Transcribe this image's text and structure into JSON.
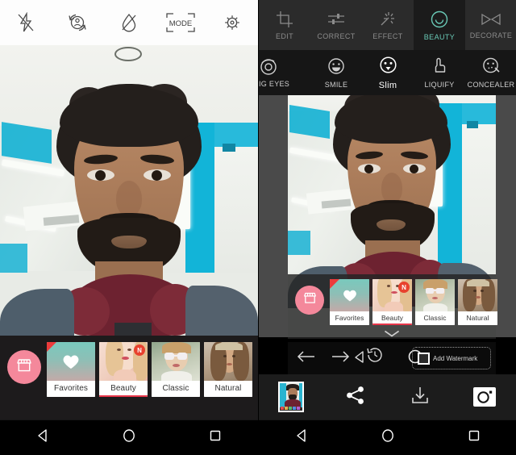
{
  "left_panel": {
    "name": "camera-screen",
    "toolbar": {
      "items": [
        {
          "icon": "flash-off-icon",
          "label": ""
        },
        {
          "icon": "switch-camera-icon",
          "label": ""
        },
        {
          "icon": "water-drop-icon",
          "label": ""
        },
        {
          "icon": "mode-icon",
          "label": "MODE"
        },
        {
          "icon": "settings-gear-icon",
          "label": ""
        }
      ]
    },
    "filter_bar": {
      "shop_icon": "store-icon",
      "collapse_icon": "chevron-down-icon",
      "filters": [
        {
          "label": "Favorites",
          "thumb": "heart-gradient",
          "selected": false,
          "new_badge": false,
          "corner_flag": true
        },
        {
          "label": "Beauty",
          "thumb": "portrait-blonde",
          "selected": true,
          "new_badge": true,
          "badge_text": "N",
          "corner_flag": false
        },
        {
          "label": "Classic",
          "thumb": "portrait-sunglasses",
          "selected": false,
          "new_badge": false,
          "corner_flag": false
        },
        {
          "label": "Natural",
          "thumb": "portrait-flowers",
          "selected": false,
          "new_badge": false,
          "corner_flag": false
        }
      ]
    }
  },
  "right_panel": {
    "name": "photo-editor-screen",
    "tabs": [
      {
        "label": "EDIT",
        "icon": "crop-icon",
        "active": false
      },
      {
        "label": "CORRECT",
        "icon": "sliders-icon",
        "active": false
      },
      {
        "label": "EFFECT",
        "icon": "sparkle-wand-icon",
        "active": false
      },
      {
        "label": "BEAUTY",
        "icon": "smiley-face-icon",
        "active": true
      },
      {
        "label": "DECORATE",
        "icon": "bowtie-icon",
        "active": false
      }
    ],
    "sub_tools": [
      {
        "label": "IG EYES",
        "icon": "big-eyes-icon",
        "active": false
      },
      {
        "label": "SMILE",
        "icon": "smile-face-icon",
        "active": false
      },
      {
        "label": "Slim",
        "icon": "slim-face-icon",
        "active": true
      },
      {
        "label": "LIQUIFY",
        "icon": "hand-pointer-icon",
        "active": false
      },
      {
        "label": "CONCEALER",
        "icon": "concealer-face-icon",
        "active": false
      }
    ],
    "filter_bar": {
      "shop_icon": "store-icon",
      "collapse_icon": "chevron-down-icon",
      "filters": [
        {
          "label": "Favorites",
          "thumb": "heart-gradient",
          "selected": false,
          "new_badge": false,
          "corner_flag": true
        },
        {
          "label": "Beauty",
          "thumb": "portrait-blonde",
          "selected": true,
          "new_badge": true,
          "badge_text": "N",
          "corner_flag": false
        },
        {
          "label": "Classic",
          "thumb": "portrait-sunglasses",
          "selected": false,
          "new_badge": false,
          "corner_flag": false
        },
        {
          "label": "Natural",
          "thumb": "portrait-flowers",
          "selected": false,
          "new_badge": false,
          "corner_flag": false
        }
      ]
    },
    "history_bar": {
      "undo_icon": "arrow-left-icon",
      "redo_icon": "arrow-right-icon",
      "play_icon": "triangle-left-icon",
      "history_icon": "history-clock-icon",
      "compare_icon": "circle-icon",
      "watermark": {
        "label": "Add Watermark",
        "checked": false,
        "icon": "checkbox-icon"
      }
    },
    "bottom_bar": [
      {
        "icon": "photo-thumbnail",
        "label": ""
      },
      {
        "icon": "share-icon",
        "label": ""
      },
      {
        "icon": "download-icon",
        "label": ""
      },
      {
        "icon": "camera-icon",
        "label": ""
      }
    ]
  },
  "android_nav": {
    "items": [
      {
        "icon": "back-triangle-icon",
        "label": ""
      },
      {
        "icon": "home-circle-icon",
        "label": ""
      },
      {
        "icon": "recents-square-icon",
        "label": ""
      }
    ]
  },
  "colors": {
    "accent_pink": "#f4889b",
    "accent_teal": "#69c9b6",
    "selected_red": "#e8364a",
    "badge_red": "#e8412e",
    "toolbar_bg": "#fdfdfd",
    "editor_bg": "#2b2b2b",
    "canvas_bg": "#4a4a4a"
  }
}
